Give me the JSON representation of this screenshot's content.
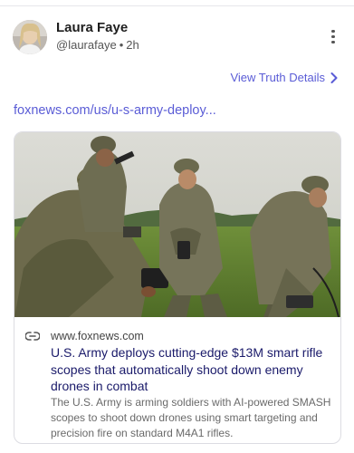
{
  "author": {
    "name": "Laura Faye",
    "handle": "@laurafaye",
    "time": "2h",
    "separator": "•"
  },
  "actions": {
    "truth_details_label": "View Truth Details",
    "more_icon": "more-vertical-icon",
    "chevron_icon": "chevron-right-icon"
  },
  "post": {
    "link_text": "foxnews.com/us/u-s-army-deploy..."
  },
  "card": {
    "image_alt": "Soldiers in camouflage operating equipment in a grassy field",
    "link_icon": "link-icon",
    "domain": "www.foxnews.com",
    "title": "U.S. Army deploys cutting-edge $13M smart rifle scopes that automatically shoot down enemy drones in combat",
    "description": "The U.S. Army is arming soldiers with AI-powered SMASH scopes to shoot down drones using smart targeting and precision fire on standard M4A1 rifles."
  },
  "colors": {
    "accent": "#5a5cd6",
    "title": "#1a1a6a",
    "muted": "#6a6a6a"
  }
}
